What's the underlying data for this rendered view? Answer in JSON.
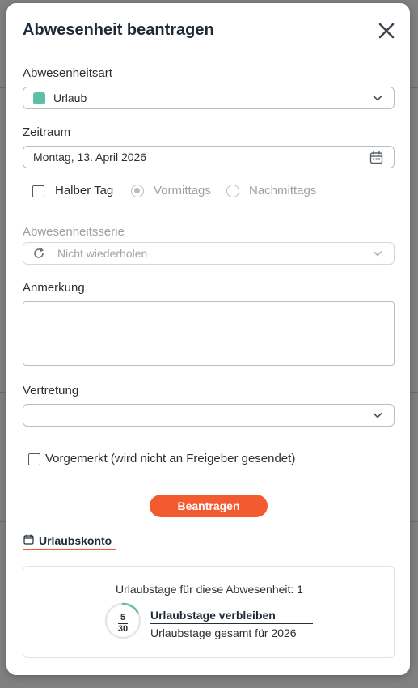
{
  "dialog": {
    "title": "Abwesenheit beantragen"
  },
  "absence_type": {
    "label": "Abwesenheitsart",
    "value": "Urlaub",
    "swatch_color": "#5cbfa6"
  },
  "period": {
    "label": "Zeitraum",
    "value": "Montag, 13. April 2026",
    "half_day_label": "Halber Tag",
    "half_day_checked": false,
    "morning_label": "Vormittags",
    "afternoon_label": "Nachmittags",
    "selected": "Vormittags"
  },
  "series": {
    "label": "Abwesenheitsserie",
    "value": "Nicht wiederholen"
  },
  "note": {
    "label": "Anmerkung",
    "value": ""
  },
  "substitute": {
    "label": "Vertretung",
    "value": ""
  },
  "reserved": {
    "label": "Vorgemerkt (wird nicht an Freigeber gesendet)",
    "checked": false
  },
  "submit_label": "Beantragen",
  "tab": {
    "label": "Urlaubskonto"
  },
  "account": {
    "days_text": "Urlaubstage für diese Abwesenheit: 1",
    "remaining": "5",
    "total": "30",
    "remaining_fraction": 0.1667,
    "remaining_title": "Urlaubstage verbleiben",
    "total_subtitle": "Urlaubstage gesamt für 2026"
  },
  "colors": {
    "accent": "#f25a30",
    "ring": "#5cbfa6"
  }
}
